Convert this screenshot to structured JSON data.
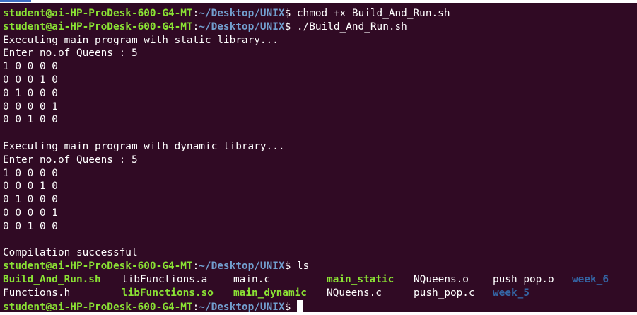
{
  "prompt": {
    "user_host": "student@ai-HP-ProDesk-600-G4-MT",
    "colon": ":",
    "path": "~/Desktop/UNIX",
    "symbol": "$"
  },
  "commands": {
    "chmod": " chmod +x Build_And_Run.sh",
    "run": " ./Build_And_Run.sh",
    "ls": " ls"
  },
  "output": {
    "static_header": "Executing main program with static library...",
    "static_queens_prompt": "Enter no.of Queens : 5",
    "static_board": [
      "1 0 0 0 0",
      "0 0 0 1 0",
      "0 1 0 0 0",
      "0 0 0 0 1",
      "0 0 1 0 0"
    ],
    "dynamic_header": "Executing main program with dynamic library...",
    "dynamic_queens_prompt": "Enter no.of Queens : 5",
    "dynamic_board": [
      "1 0 0 0 0",
      "0 0 0 1 0",
      "0 1 0 0 0",
      "0 0 0 0 1",
      "0 0 1 0 0"
    ],
    "compilation": "Compilation successful"
  },
  "ls_listing": {
    "row1": [
      "Build_And_Run.sh",
      "libFunctions.a",
      "main.c",
      "main_static",
      "NQueens.o",
      "push_pop.o",
      "week_6"
    ],
    "row2": [
      "Functions.h",
      "libFunctions.so",
      "main_dynamic",
      "NQueens.c",
      "push_pop.c",
      "week_5"
    ]
  },
  "colors": {
    "background": "#300a24",
    "prompt_user": "#8ae234",
    "prompt_path": "#729fcf",
    "executable": "#8ae234",
    "directory": "#3465a4",
    "text": "#ffffff"
  }
}
